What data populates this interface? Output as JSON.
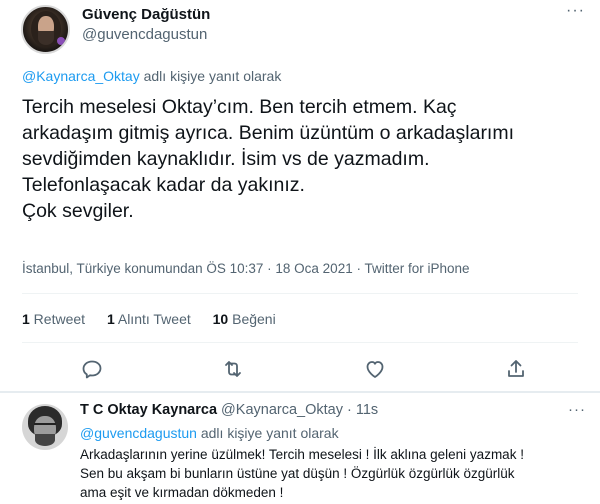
{
  "main_tweet": {
    "display_name": "Güvenç Dağüstün",
    "handle": "@guvencdagustun",
    "more_label": "···",
    "reply_context": {
      "mention": "@Kaynarca_Oktay",
      "suffix": " adlı kişiye yanıt olarak"
    },
    "text_lines": [
      "Tercih meselesi Oktay’cım. Ben tercih etmem. Kaç",
      "arkadaşım gitmiş ayrıca. Benim üzüntüm o arkadaşlarımı",
      "sevdiğimden kaynaklıdır. İsim vs de yazmadım.",
      "Telefonlaşacak kadar da yakınız.",
      "Çok sevgiler."
    ],
    "meta": "İstanbul, Türkiye konumundan ÖS 10:37 · 18 Oca 2021 · Twitter for iPhone",
    "stats": {
      "retweets_count": "1",
      "retweets_label": " Retweet",
      "quotes_count": "1",
      "quotes_label": " Alıntı Tweet",
      "likes_count": "10",
      "likes_label": " Beğeni"
    },
    "actions": [
      "reply-icon",
      "retweet-icon",
      "like-icon",
      "share-icon"
    ]
  },
  "reply_tweet": {
    "display_name": "T C Oktay Kaynarca",
    "handle": "@Kaynarca_Oktay",
    "dot": "·",
    "time": "11s",
    "more_label": "···",
    "reply_context": {
      "mention": "@guvencdagustun",
      "suffix": " adlı kişiye yanıt olarak"
    },
    "text_lines": [
      "Arkadaşlarının yerine üzülmek! Tercih meselesi ! İlk aklına geleni yazmak !",
      "Sen bu akşam bi bunların üstüne yat düşün ! Özgürlük özgürlük özgürlük",
      "ama eşit ve kırmadan dökmeden !"
    ]
  },
  "colors": {
    "link": "#1d9bf0",
    "secondary_text": "#536471",
    "primary_text": "#0f1419",
    "divider": "#eff3f4"
  }
}
